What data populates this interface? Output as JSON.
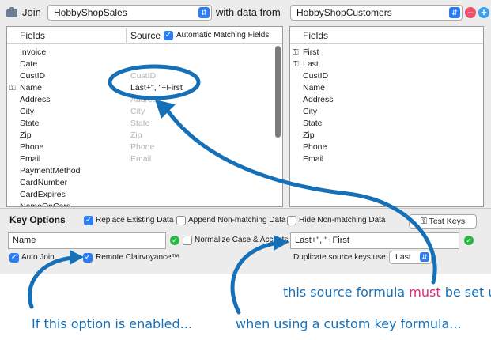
{
  "header": {
    "join_label": "Join",
    "join_table": "HobbyShopSales",
    "with_label": "with data from",
    "source_table": "HobbyShopCustomers",
    "remove_icon": "minus-circle-icon",
    "add_icon": "plus-circle-icon"
  },
  "target_table": {
    "col_fields": "Fields",
    "col_source": "Source",
    "auto_match_label": "Automatic Matching Fields",
    "auto_match_checked": true,
    "rows": [
      {
        "field": "Invoice",
        "source": "",
        "key": false,
        "active": false
      },
      {
        "field": "Date",
        "source": "",
        "key": false,
        "active": false
      },
      {
        "field": "CustID",
        "source": "CustID",
        "key": false,
        "active": false
      },
      {
        "field": "Name",
        "source": "Last+\", \"+First",
        "key": true,
        "active": true
      },
      {
        "field": "Address",
        "source": "Address",
        "key": false,
        "active": false
      },
      {
        "field": "City",
        "source": "City",
        "key": false,
        "active": false
      },
      {
        "field": "State",
        "source": "State",
        "key": false,
        "active": false
      },
      {
        "field": "Zip",
        "source": "Zip",
        "key": false,
        "active": false
      },
      {
        "field": "Phone",
        "source": "Phone",
        "key": false,
        "active": false
      },
      {
        "field": "Email",
        "source": "Email",
        "key": false,
        "active": false
      },
      {
        "field": "PaymentMethod",
        "source": "",
        "key": false,
        "active": false
      },
      {
        "field": "CardNumber",
        "source": "",
        "key": false,
        "active": false
      },
      {
        "field": "CardExpires",
        "source": "",
        "key": false,
        "active": false
      },
      {
        "field": "NameOnCard",
        "source": "",
        "key": false,
        "active": false
      }
    ]
  },
  "source_fields": {
    "col_fields": "Fields",
    "rows": [
      {
        "field": "First",
        "key": true
      },
      {
        "field": "Last",
        "key": true
      },
      {
        "field": "CustID",
        "key": false
      },
      {
        "field": "Name",
        "key": false
      },
      {
        "field": "Address",
        "key": false
      },
      {
        "field": "City",
        "key": false
      },
      {
        "field": "State",
        "key": false
      },
      {
        "field": "Zip",
        "key": false
      },
      {
        "field": "Phone",
        "key": false
      },
      {
        "field": "Email",
        "key": false
      }
    ]
  },
  "key_options": {
    "title": "Key Options",
    "replace_existing": {
      "label": "Replace Existing Data",
      "checked": true
    },
    "append_nonmatching": {
      "label": "Append Non-matching Data",
      "checked": false
    },
    "hide_nonmatching": {
      "label": "Hide Non-matching Data",
      "checked": false
    },
    "test_keys_label": "Test Keys",
    "key_field_value": "Name",
    "normalize_label": "Normalize Case & Accents",
    "normalize_checked": false,
    "source_formula_value": "Last+\", \"+First",
    "auto_join": {
      "label": "Auto Join",
      "checked": true
    },
    "remote_clairvoyance": {
      "label": "Remote Clairvoyance™",
      "checked": true
    },
    "duplicate_label": "Duplicate source keys use:",
    "duplicate_value": "Last"
  },
  "annotations": {
    "formula_note_pre": "this source formula ",
    "formula_note_em": "must",
    "formula_note_post": " be set up",
    "option_note": "If this option is enabled...",
    "custom_key_note": "when using a custom key formula..."
  },
  "colors": {
    "accent": "#2c7cf6",
    "annotation": "#1670b8",
    "emphasis": "#e0267e",
    "ok": "#28b840",
    "remove": "#f0506e",
    "add": "#3aa0f0"
  }
}
